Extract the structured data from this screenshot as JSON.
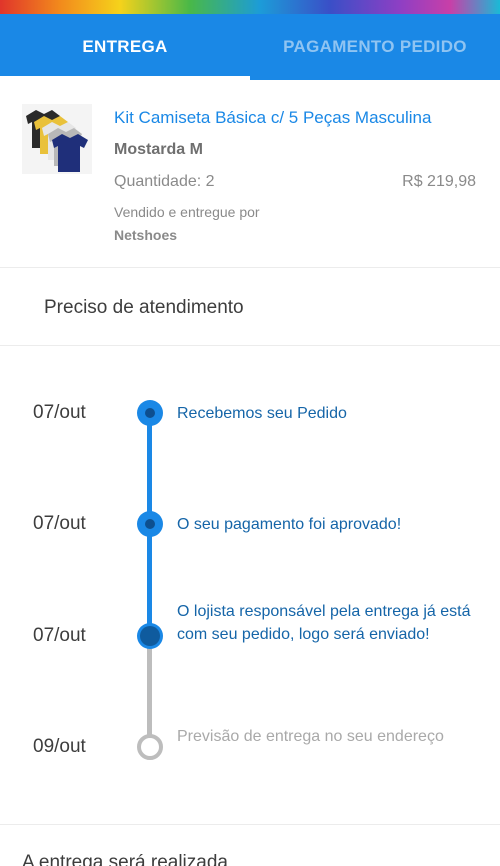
{
  "tabs": [
    {
      "label": "ENTREGA",
      "active": true
    },
    {
      "label": "PAGAMENTO PEDIDO",
      "active": false
    }
  ],
  "product": {
    "title": "Kit Camiseta Básica c/ 5 Peças Masculina",
    "variant": "Mostarda M",
    "quantity": "Quantidade: 2",
    "price": "R$ 219,98",
    "sold_by_label": "Vendido e entregue por",
    "seller": "Netshoes"
  },
  "help": {
    "label": "Preciso de atendimento"
  },
  "timeline": [
    {
      "date": "07/out",
      "text": "Recebemos seu Pedido",
      "status": "done"
    },
    {
      "date": "07/out",
      "text": "O seu pagamento foi aprovado!",
      "status": "done"
    },
    {
      "date": "07/out",
      "text": "O lojista responsável pela entrega já está com seu pedido, logo será enviado!",
      "status": "current"
    },
    {
      "date": "09/out",
      "text": "Previsão de entrega no seu endereço",
      "status": "pending"
    }
  ],
  "footer": {
    "partial_text": "A entrega será realizada"
  },
  "colors": {
    "primary": "#1a88e6",
    "step_text": "#1565a8",
    "pending": "#bdbdbd"
  }
}
